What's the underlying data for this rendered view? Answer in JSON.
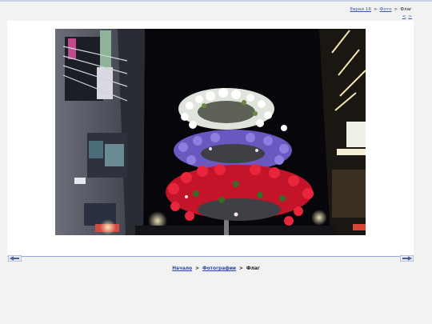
{
  "breadcrumb_top": {
    "items": [
      "Евреи 16",
      "Фото"
    ],
    "current": "Флаг",
    "separator": ">"
  },
  "mini_nav": {
    "prev": "<",
    "next": ">"
  },
  "photo": {
    "subject": "Flower tower with white, purple and red petunias at night"
  },
  "nav_arrows": {
    "prev": "previous-arrow-icon",
    "next": "next-arrow-icon"
  },
  "breadcrumb_bottom": {
    "items": [
      "Начало",
      "Фотографии"
    ],
    "current": "Флаг",
    "separator": ">"
  },
  "colors": {
    "link": "#3a5ba8",
    "background": "#f2f2f2",
    "panel": "#ffffff"
  }
}
